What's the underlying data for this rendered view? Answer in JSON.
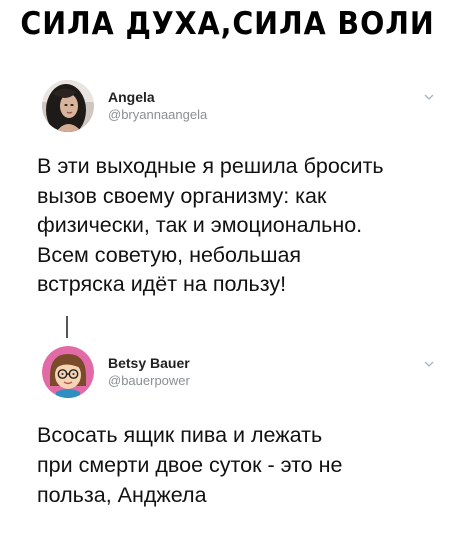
{
  "meme": {
    "title": "СИЛА ДУХА,СИЛА ВОЛИ"
  },
  "tweet1": {
    "display_name": "Angela",
    "handle": "@bryannaangela",
    "lines": [
      "В эти выходные я решила бросить",
      "вызов своему организму: как",
      "физически, так и эмоционально.",
      "Всем советую, небольшая",
      "встряска идёт на пользу!"
    ],
    "avatar_icon": "woman-photo-avatar",
    "menu_icon": "chevron-down-icon"
  },
  "tweet2": {
    "display_name": "Betsy Bauer",
    "handle": "@bauerpower",
    "lines": [
      "Всосать ящик пива и лежать",
      "при смерти двое суток - это не",
      "польза,  Анджела"
    ],
    "avatar_icon": "cartoon-avatar",
    "menu_icon": "chevron-down-icon"
  },
  "colors": {
    "text": "#111111",
    "handle": "#8a8f94",
    "avatar2_bg": "#e26aa6"
  }
}
